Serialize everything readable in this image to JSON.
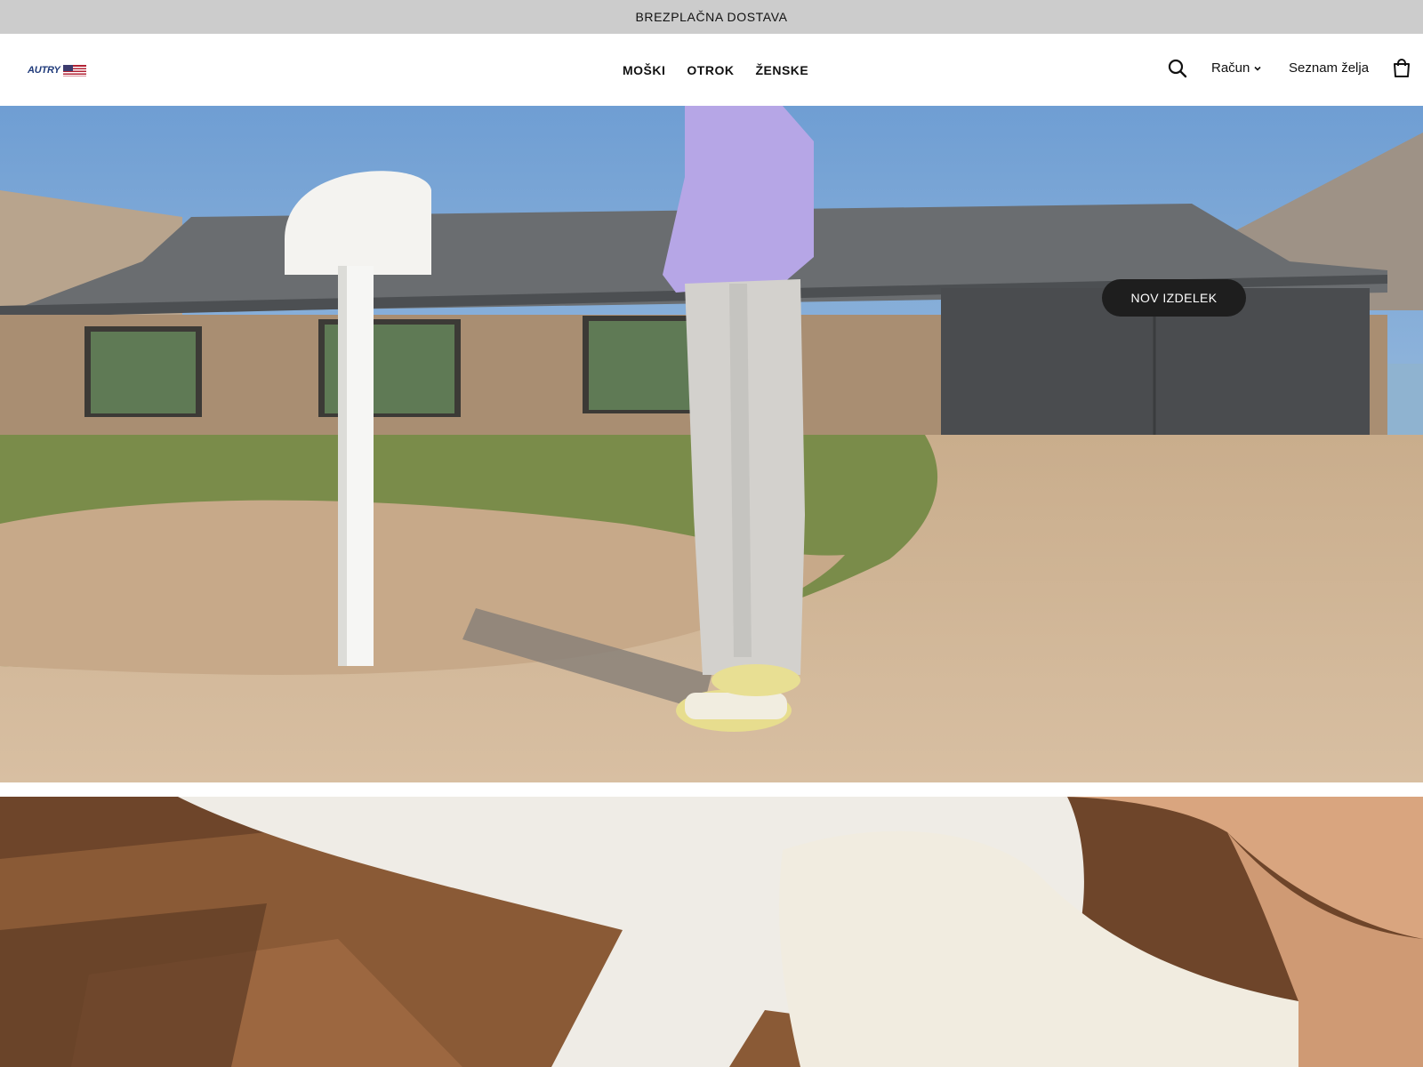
{
  "announcement": {
    "text": "BREZPLAČNA DOSTAVA"
  },
  "header": {
    "logo": {
      "text": "AUTRY",
      "icon": "us-flag-icon"
    },
    "nav": [
      {
        "label": "MOŠKI"
      },
      {
        "label": "OTROK"
      },
      {
        "label": "ŽENSKE"
      }
    ],
    "utilities": {
      "search_icon": "search-icon",
      "account_label": "Račun",
      "account_icon": "chevron-down-icon",
      "wishlist_label": "Seznam želja",
      "cart_icon": "shopping-bag-icon"
    }
  },
  "hero": {
    "badge_label": "NOV IZDELEK",
    "image": "person in lavender sweater and grey trousers standing beside white mailbox in front of house"
  },
  "second_banner": {
    "image": "close-up of legs in white ribbed socks on wooden floor"
  }
}
